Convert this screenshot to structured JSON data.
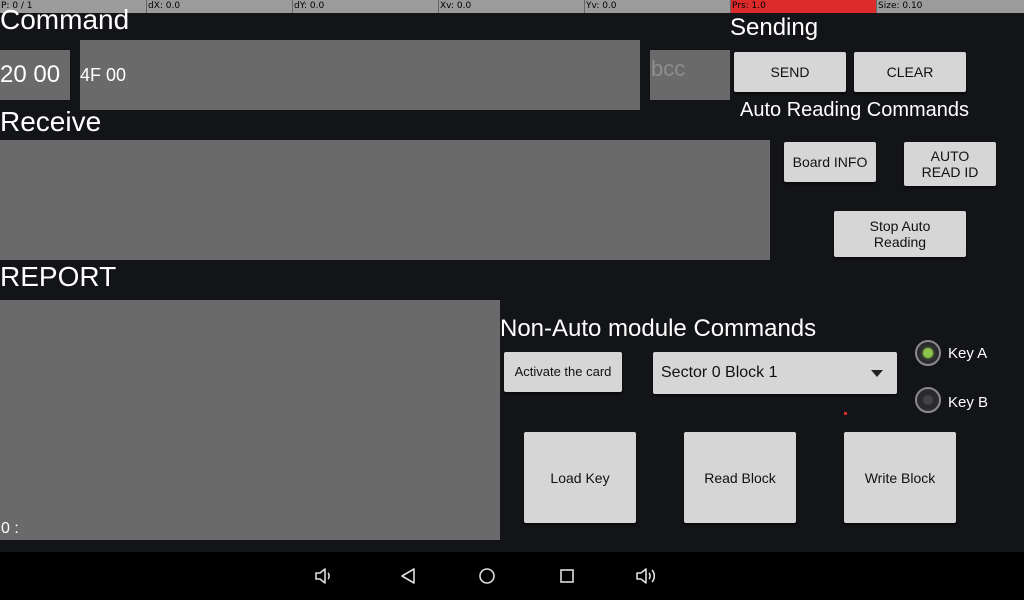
{
  "status_bar": {
    "pointer": "P: 0 / 1",
    "dx": "dX: 0.0",
    "dy": "dY: 0.0",
    "xv": "Xv: 0.0",
    "yv": "Yv: 0.0",
    "prs": "Prs: 1.0",
    "size": "Size: 0.10"
  },
  "command": {
    "title": "Command",
    "prefix_value": "20 00",
    "command_value": "4F 00",
    "bcc_placeholder": "bcc"
  },
  "sending": {
    "title": "Sending",
    "send_label": "SEND",
    "clear_label": "CLEAR"
  },
  "auto_reading": {
    "title": "Auto Reading Commands",
    "board_info_label": "Board INFO",
    "auto_read_id_label": "AUTO READ ID",
    "stop_label": "Stop Auto Reading"
  },
  "receive": {
    "title": "Receive",
    "content": ""
  },
  "report": {
    "title": "REPORT",
    "content": "0 :"
  },
  "non_auto": {
    "title": "Non-Auto module Commands",
    "activate_label": "Activate the card",
    "sector_selected": "Sector 0 Block 1",
    "key_a_label": "Key A",
    "key_b_label": "Key B",
    "key_a_selected": true,
    "load_key_label": "Load Key",
    "read_block_label": "Read Block",
    "write_block_label": "Write Block"
  },
  "colors": {
    "radio_selected": "#8bc34a",
    "status_highlight": "#dd2b2b",
    "field_gray": "#6a6a6a",
    "background": "#131417"
  },
  "icons": {
    "nav": [
      "volume-down-icon",
      "back-icon",
      "home-icon",
      "recents-icon",
      "volume-up-icon"
    ]
  }
}
